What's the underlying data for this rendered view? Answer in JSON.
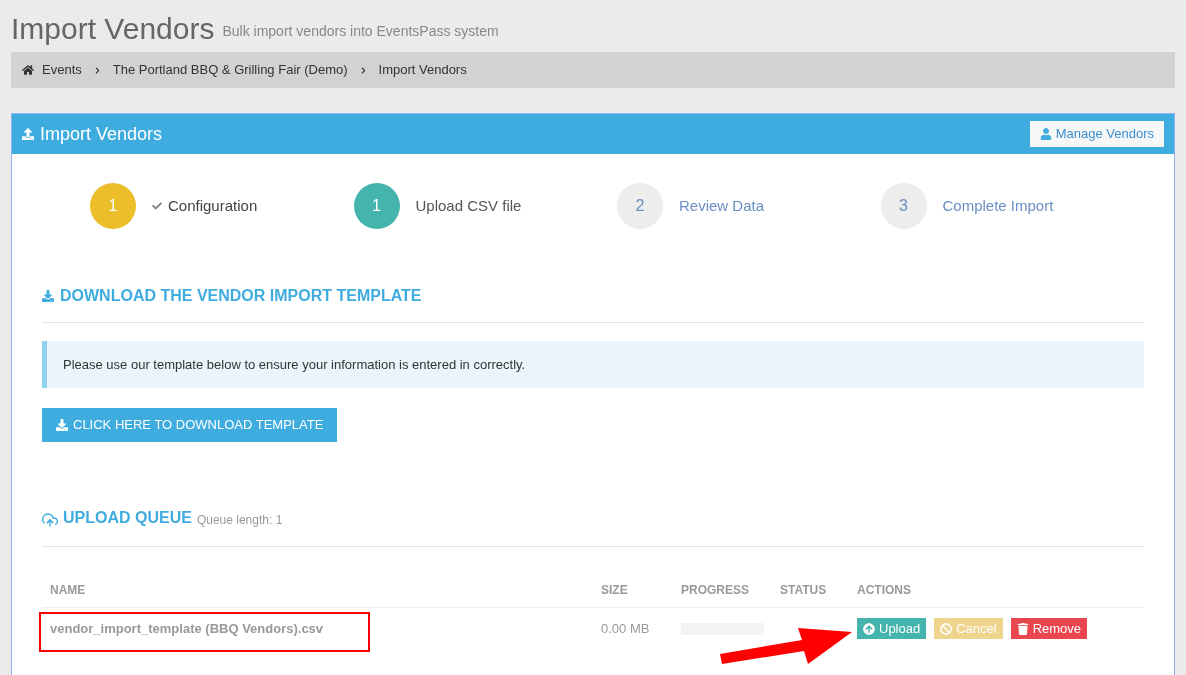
{
  "page_header": {
    "title": "Import Vendors",
    "subtitle": "Bulk import vendors into EventsPass system"
  },
  "breadcrumb": [
    "Events",
    "The Portland BBQ & Grilling Fair (Demo)",
    "Import Vendors"
  ],
  "panel": {
    "title": "Import Vendors",
    "header_button": "Manage Vendors"
  },
  "steps": [
    {
      "number": "1",
      "label": "Configuration",
      "completed": true,
      "selected": false
    },
    {
      "number": "1",
      "label": "Upload CSV file",
      "completed": false,
      "selected": true
    },
    {
      "number": "2",
      "label": "Review Data",
      "completed": false,
      "selected": false
    },
    {
      "number": "3",
      "label": "Complete Import",
      "completed": false,
      "selected": false
    }
  ],
  "download_section": {
    "heading": "DOWNLOAD THE VENDOR IMPORT TEMPLATE",
    "info": "Please use our template below to ensure your information is entered in correctly.",
    "button": "CLICK HERE TO DOWNLOAD TEMPLATE"
  },
  "upload_queue": {
    "heading": "UPLOAD QUEUE",
    "queue_length": "Queue length: 1"
  },
  "table": {
    "columns": [
      "NAME",
      "SIZE",
      "PROGRESS",
      "STATUS",
      "ACTIONS"
    ],
    "rows": [
      {
        "name": "vendor_import_template (BBQ Vendors).csv",
        "size": "0.00 MB",
        "progress": {
          "level": 0
        },
        "actions": [
          {
            "kind": "upload",
            "label": "Upload",
            "disabled": false
          },
          {
            "kind": "cancel",
            "label": "Cancel",
            "disabled": true
          },
          {
            "kind": "remove",
            "label": "Remove",
            "disabled": false
          }
        ]
      }
    ]
  }
}
